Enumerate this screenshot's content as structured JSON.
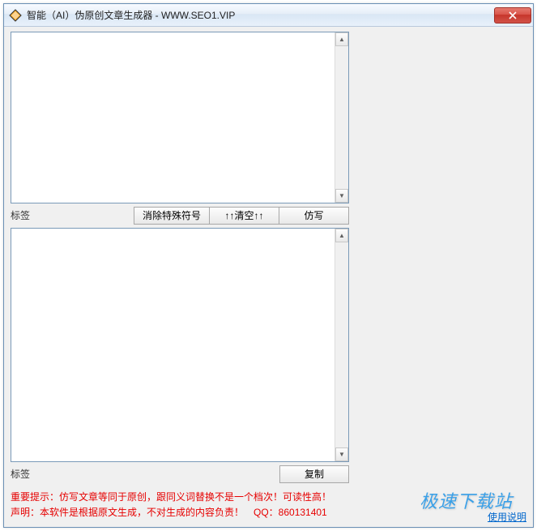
{
  "window": {
    "title": "智能（AI）伪原创文章生成器 - WWW.SEO1.VIP"
  },
  "labels": {
    "tag_top": "标签",
    "tag_bottom": "标签"
  },
  "buttons": {
    "remove_special": "消除特殊符号",
    "clear": "↑↑清空↑↑",
    "rewrite": "仿写",
    "copy": "复制"
  },
  "textarea_top": {
    "value": ""
  },
  "textarea_bottom": {
    "value": ""
  },
  "notes": {
    "line1": "重要提示：仿写文章等同于原创，跟同义词替换不是一个档次！可读性高！",
    "line2": "声明：本软件是根据原文生成，不对生成的内容负责！　QQ：860131401"
  },
  "corner": {
    "link": "使用说明"
  },
  "watermark": {
    "text": "极速下载站"
  }
}
